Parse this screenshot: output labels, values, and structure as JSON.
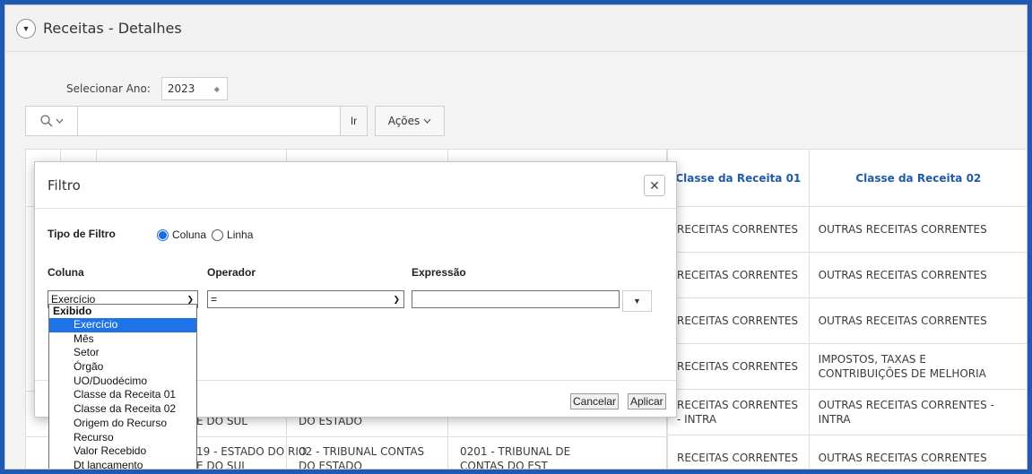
{
  "region": {
    "title": "Receitas - Detalhes"
  },
  "year": {
    "label": "Selecionar Ano:",
    "value": "2023"
  },
  "toolbar": {
    "go_label": "Ir",
    "actions_label": "Ações"
  },
  "table": {
    "columns": [
      "Classe da Receita 01",
      "Classe da Receita 02"
    ],
    "rows": [
      [
        "RECEITAS CORRENTES",
        "OUTRAS RECEITAS CORRENTES"
      ],
      [
        "RECEITAS CORRENTES",
        "OUTRAS RECEITAS CORRENTES"
      ],
      [
        "RECEITAS CORRENTES",
        "OUTRAS RECEITAS CORRENTES"
      ],
      [
        "RECEITAS CORRENTES",
        "IMPOSTOS, TAXAS E CONTRIBUIÇÕES DE MELHORIA"
      ],
      [
        "RECEITAS CORRENTES - INTRA",
        "OUTRAS RECEITAS CORRENTES - INTRA"
      ],
      [
        "RECEITAS CORRENTES",
        "OUTRAS RECEITAS CORRENTES"
      ]
    ],
    "partial_row5": {
      "c1": "E DO SUL",
      "c2": "DO ESTADO"
    },
    "partial_row6": {
      "c1a": "19 - ESTADO DO RIO",
      "c1b": "E DO SUL",
      "c2a": "02 - TRIBUNAL CONTAS",
      "c2b": "DO ESTADO",
      "c3a": "0201 - TRIBUNAL DE",
      "c3b": "CONTAS DO EST"
    }
  },
  "dialog": {
    "title": "Filtro",
    "filter_type_label": "Tipo de Filtro",
    "radio_column": "Coluna",
    "radio_row": "Linha",
    "column_label": "Coluna",
    "operator_label": "Operador",
    "expression_label": "Expressão",
    "column_value": "Exercício",
    "operator_value": "=",
    "expression_value": "",
    "cancel_label": "Cancelar",
    "apply_label": "Aplicar"
  },
  "dropdown": {
    "group": "Exibido",
    "items": [
      "Exercício",
      "Mês",
      "Setor",
      "Órgão",
      "UO/Duodécimo",
      "Classe da Receita 01",
      "Classe da Receita 02",
      "Origem do Recurso",
      "Recurso",
      "Valor Recebido",
      "Dt lancamento"
    ],
    "selected_index": 0
  },
  "colors": {
    "border_blue": "#1e5ab4",
    "header_link": "#1f5ba8",
    "selection": "#1e73e8"
  }
}
